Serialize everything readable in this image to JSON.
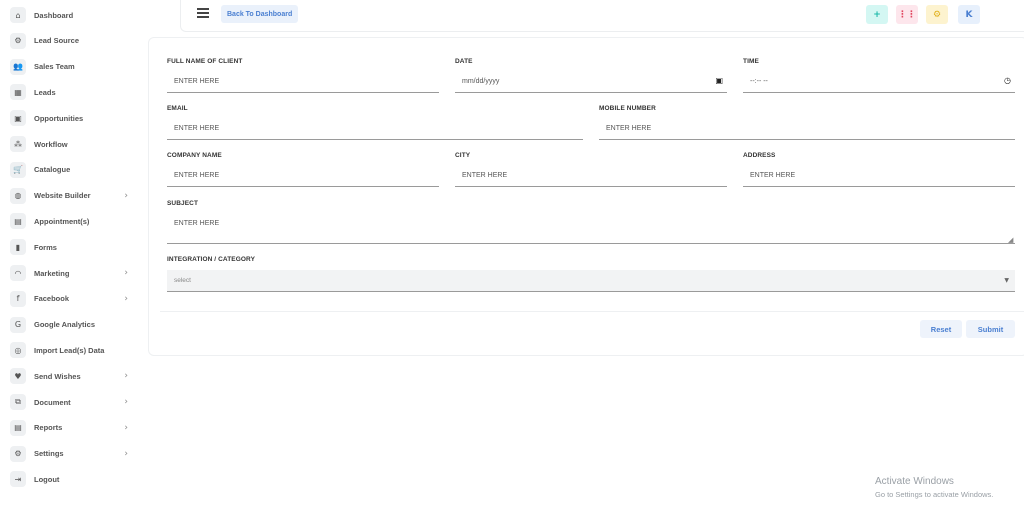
{
  "sidebar": {
    "items": [
      {
        "label": "Dashboard",
        "icon": "⌂",
        "chevron": ""
      },
      {
        "label": "Lead Source",
        "icon": "⚙",
        "chevron": ""
      },
      {
        "label": "Sales Team",
        "icon": "👥",
        "chevron": ""
      },
      {
        "label": "Leads",
        "icon": "▦",
        "chevron": ""
      },
      {
        "label": "Opportunities",
        "icon": "▣",
        "chevron": ""
      },
      {
        "label": "Workflow",
        "icon": "⁂",
        "chevron": ""
      },
      {
        "label": "Catalogue",
        "icon": "🛒",
        "chevron": ""
      },
      {
        "label": "Website Builder",
        "icon": "◍",
        "chevron": "›"
      },
      {
        "label": "Appointment(s)",
        "icon": "▤",
        "chevron": ""
      },
      {
        "label": "Forms",
        "icon": "▮",
        "chevron": ""
      },
      {
        "label": "Marketing",
        "icon": "◠",
        "chevron": "›"
      },
      {
        "label": "Facebook",
        "icon": "f",
        "chevron": "›"
      },
      {
        "label": "Google Analytics",
        "icon": "G",
        "chevron": ""
      },
      {
        "label": "Import Lead(s) Data",
        "icon": "◎",
        "chevron": ""
      },
      {
        "label": "Send Wishes",
        "icon": "♥",
        "chevron": "›"
      },
      {
        "label": "Document",
        "icon": "⧉",
        "chevron": "›"
      },
      {
        "label": "Reports",
        "icon": "▤",
        "chevron": "›"
      },
      {
        "label": "Settings",
        "icon": "⚙",
        "chevron": "›"
      },
      {
        "label": "Logout",
        "icon": "⇥",
        "chevron": ""
      }
    ]
  },
  "topbar": {
    "back_label": "Back To Dashboard",
    "icons": [
      {
        "name": "plus-icon",
        "glyph": "+",
        "bg": "#d4f7f3",
        "color": "#1bb9a9"
      },
      {
        "name": "apps-grid-icon",
        "glyph": "⋮⋮",
        "bg": "#fde6ec",
        "color": "#e0455f"
      },
      {
        "name": "settings-gear-icon",
        "glyph": "⚙",
        "bg": "#fdf3cf",
        "color": "#e0b01a"
      },
      {
        "name": "user-avatar-icon",
        "glyph": "K",
        "bg": "#e7f0fc",
        "color": "#4a7fd1"
      }
    ]
  },
  "form": {
    "full_name": {
      "label": "FULL NAME OF CLIENT",
      "placeholder": "ENTER HERE"
    },
    "date": {
      "label": "DATE",
      "placeholder": "mm/dd/yyyy"
    },
    "time": {
      "label": "TIME",
      "placeholder": "--:-- --"
    },
    "email": {
      "label": "EMAIL",
      "placeholder": "ENTER HERE"
    },
    "mobile": {
      "label": "MOBILE NUMBER",
      "placeholder": "ENTER HERE"
    },
    "company": {
      "label": "COMPANY NAME",
      "placeholder": "ENTER HERE"
    },
    "city": {
      "label": "CITY",
      "placeholder": "ENTER HERE"
    },
    "address": {
      "label": "ADDRESS",
      "placeholder": "ENTER HERE"
    },
    "subject": {
      "label": "SUBJECT",
      "placeholder": "ENTER HERE"
    },
    "category": {
      "label": "INTEGRATION / CATEGORY",
      "selected": "select"
    }
  },
  "actions": {
    "reset": "Reset",
    "submit": "Submit"
  },
  "watermark": {
    "line1": "Activate Windows",
    "line2": "Go to Settings to activate Windows."
  }
}
